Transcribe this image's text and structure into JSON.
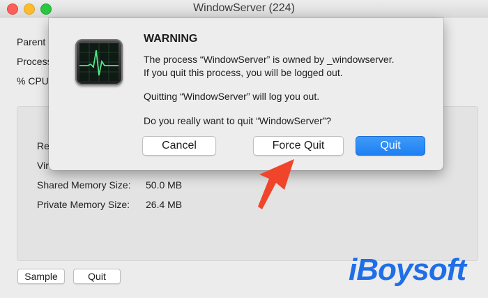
{
  "window": {
    "title": "WindowServer (224)"
  },
  "info_labels": {
    "parent": "Parent",
    "process": "Process",
    "cpu": "% CPU:"
  },
  "memory": {
    "rows": [
      {
        "label": "Re",
        "value": ""
      },
      {
        "label": "Vir",
        "value": ""
      },
      {
        "label": "Shared Memory Size:",
        "value": "50.0 MB"
      },
      {
        "label": "Private Memory Size:",
        "value": "26.4 MB"
      }
    ]
  },
  "bottom_buttons": {
    "sample": "Sample",
    "quit": "Quit"
  },
  "dialog": {
    "title": "WARNING",
    "line1": "The process “WindowServer” is owned by _windowserver.",
    "line2": "If you quit this process, you will be logged out.",
    "line3": "Quitting “WindowServer” will log you out.",
    "line4": "Do you really want to quit “WindowServer”?",
    "cancel": "Cancel",
    "force_quit": "Force Quit",
    "quit": "Quit",
    "icon": "activity-monitor-icon"
  },
  "annotation": {
    "arrow_color": "#f0452a"
  },
  "watermark": {
    "text": "iBoysoft",
    "color": "#1f6ee8"
  }
}
